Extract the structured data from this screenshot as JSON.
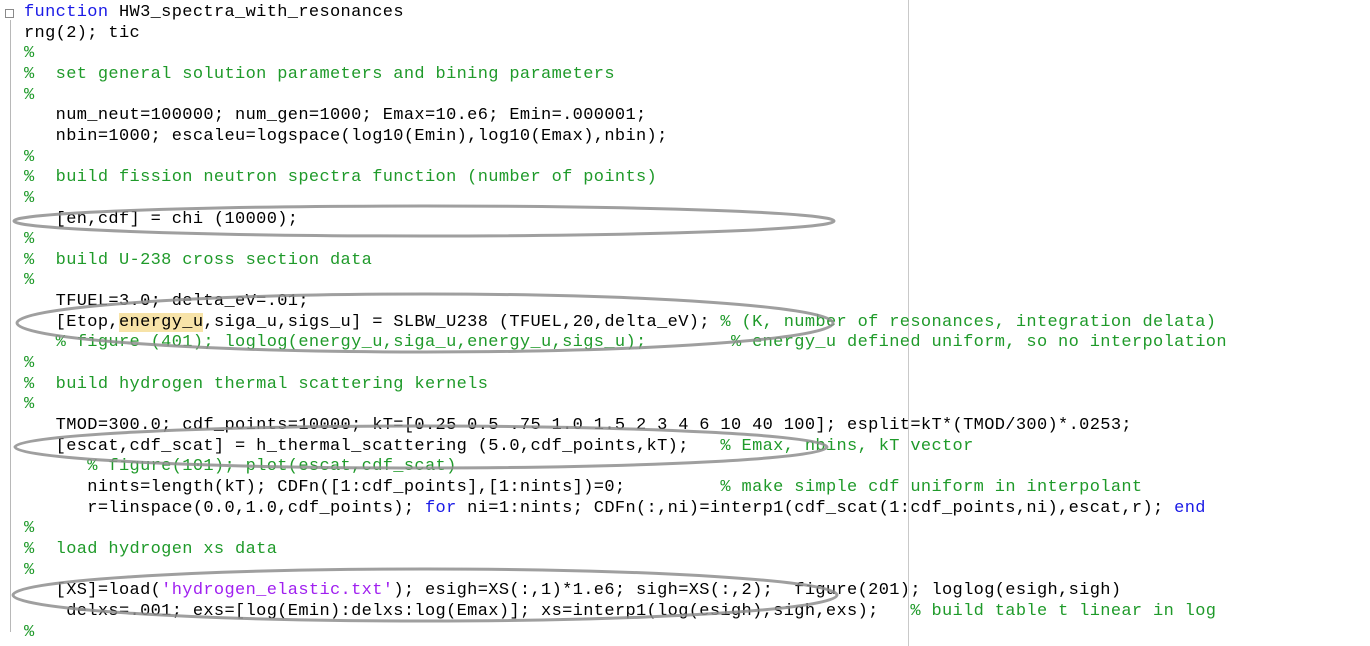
{
  "editor": {
    "fold_symbol": "⊟",
    "lines": [
      {
        "key": "L1",
        "segments": [
          {
            "t": "kw",
            "v": "function"
          },
          {
            "t": "plain",
            "v": " HW3_spectra_with_resonances"
          }
        ]
      },
      {
        "key": "L2",
        "segments": [
          {
            "t": "plain",
            "v": "rng(2); tic"
          }
        ]
      },
      {
        "key": "L3",
        "segments": [
          {
            "t": "cm",
            "v": "%"
          }
        ]
      },
      {
        "key": "L4",
        "segments": [
          {
            "t": "cm",
            "v": "%  set general solution parameters and bining parameters"
          }
        ]
      },
      {
        "key": "L5",
        "segments": [
          {
            "t": "cm",
            "v": "%"
          }
        ]
      },
      {
        "key": "L6",
        "segments": [
          {
            "t": "plain",
            "v": "   num_neut=100000; num_gen=1000; Emax=10.e6; Emin=.000001;"
          }
        ]
      },
      {
        "key": "L7",
        "segments": [
          {
            "t": "plain",
            "v": "   nbin=1000; escaleu=logspace(log10(Emin),log10(Emax),nbin);"
          }
        ]
      },
      {
        "key": "L8",
        "segments": [
          {
            "t": "cm",
            "v": "%"
          }
        ]
      },
      {
        "key": "L9",
        "segments": [
          {
            "t": "cm",
            "v": "%  build fission neutron spectra function (number of points)"
          }
        ]
      },
      {
        "key": "L10",
        "segments": [
          {
            "t": "cm",
            "v": "%"
          }
        ]
      },
      {
        "key": "L11",
        "segments": [
          {
            "t": "plain",
            "v": "   [en,cdf] = chi (10000);"
          }
        ]
      },
      {
        "key": "L12",
        "segments": [
          {
            "t": "cm",
            "v": "%"
          }
        ]
      },
      {
        "key": "L13",
        "segments": [
          {
            "t": "cm",
            "v": "%  build U-238 cross section data"
          }
        ]
      },
      {
        "key": "L14",
        "segments": [
          {
            "t": "cm",
            "v": "%"
          }
        ]
      },
      {
        "key": "L15",
        "segments": [
          {
            "t": "plain",
            "v": "   TFUEL=3.0; delta_eV=.01;"
          }
        ]
      },
      {
        "key": "L16",
        "segments": [
          {
            "t": "plain",
            "v": "   [Etop,"
          },
          {
            "t": "hl",
            "v": "energy_u"
          },
          {
            "t": "plain",
            "v": ",siga_u,sigs_u] = SLBW_U238 (TFUEL,20,delta_eV); "
          },
          {
            "t": "cm",
            "v": "% (K, number of resonances, integration delata)"
          }
        ]
      },
      {
        "key": "L17",
        "segments": [
          {
            "t": "cm",
            "v": "   % figure (401); loglog(energy_u,siga_u,energy_u,sigs_u);        % energy_u defined uniform, so no interpolation"
          }
        ]
      },
      {
        "key": "L18",
        "segments": [
          {
            "t": "cm",
            "v": "%"
          }
        ]
      },
      {
        "key": "L19",
        "segments": [
          {
            "t": "cm",
            "v": "%  build hydrogen thermal scattering kernels"
          }
        ]
      },
      {
        "key": "L20",
        "segments": [
          {
            "t": "cm",
            "v": "%"
          }
        ]
      },
      {
        "key": "L21",
        "segments": [
          {
            "t": "plain",
            "v": "   TMOD=300.0; cdf_points=10000; kT=[0.25 0.5 .75 1.0 1.5 2 3 4 6 10 40 100]; esplit=kT*(TMOD/300)*.0253;"
          }
        ]
      },
      {
        "key": "L22",
        "segments": [
          {
            "t": "plain",
            "v": "   [escat,cdf_scat] = h_thermal_scattering (5.0,cdf_points,kT);   "
          },
          {
            "t": "cm",
            "v": "% Emax, nbins, kT vector"
          }
        ]
      },
      {
        "key": "L23",
        "segments": [
          {
            "t": "cm",
            "v": "      % figure(101); plot(escat,cdf_scat)"
          }
        ]
      },
      {
        "key": "L24",
        "segments": [
          {
            "t": "plain",
            "v": "      nints=length(kT); CDFn([1:cdf_points],[1:nints])=0;         "
          },
          {
            "t": "cm",
            "v": "% make simple cdf uniform in interpolant"
          }
        ]
      },
      {
        "key": "L25",
        "segments": [
          {
            "t": "plain",
            "v": "      r=linspace(0.0,1.0,cdf_points); "
          },
          {
            "t": "kw",
            "v": "for"
          },
          {
            "t": "plain",
            "v": " ni=1:nints; CDFn(:,ni)=interp1(cdf_scat(1:cdf_points,ni),escat,r); "
          },
          {
            "t": "kw",
            "v": "end"
          }
        ]
      },
      {
        "key": "L26",
        "segments": [
          {
            "t": "cm",
            "v": "%"
          }
        ]
      },
      {
        "key": "L27",
        "segments": [
          {
            "t": "cm",
            "v": "%  load hydrogen xs data"
          }
        ]
      },
      {
        "key": "L28",
        "segments": [
          {
            "t": "cm",
            "v": "%"
          }
        ]
      },
      {
        "key": "L29",
        "segments": [
          {
            "t": "plain",
            "v": "   [XS]=load("
          },
          {
            "t": "str",
            "v": "'hydrogen_elastic.txt'"
          },
          {
            "t": "plain",
            "v": "); esigh=XS(:,1)*1.e6; sigh=XS(:,2);  figure(201); loglog(esigh,sigh)"
          }
        ]
      },
      {
        "key": "L30",
        "segments": [
          {
            "t": "plain",
            "v": "    delxs=.001; exs=[log(Emin):delxs:log(Emax)]; xs=interp1(log(esigh),sigh,exs);   "
          },
          {
            "t": "cm",
            "v": "% build table t linear in log"
          }
        ]
      },
      {
        "key": "L31",
        "segments": [
          {
            "t": "cm",
            "v": "%"
          }
        ]
      }
    ]
  }
}
